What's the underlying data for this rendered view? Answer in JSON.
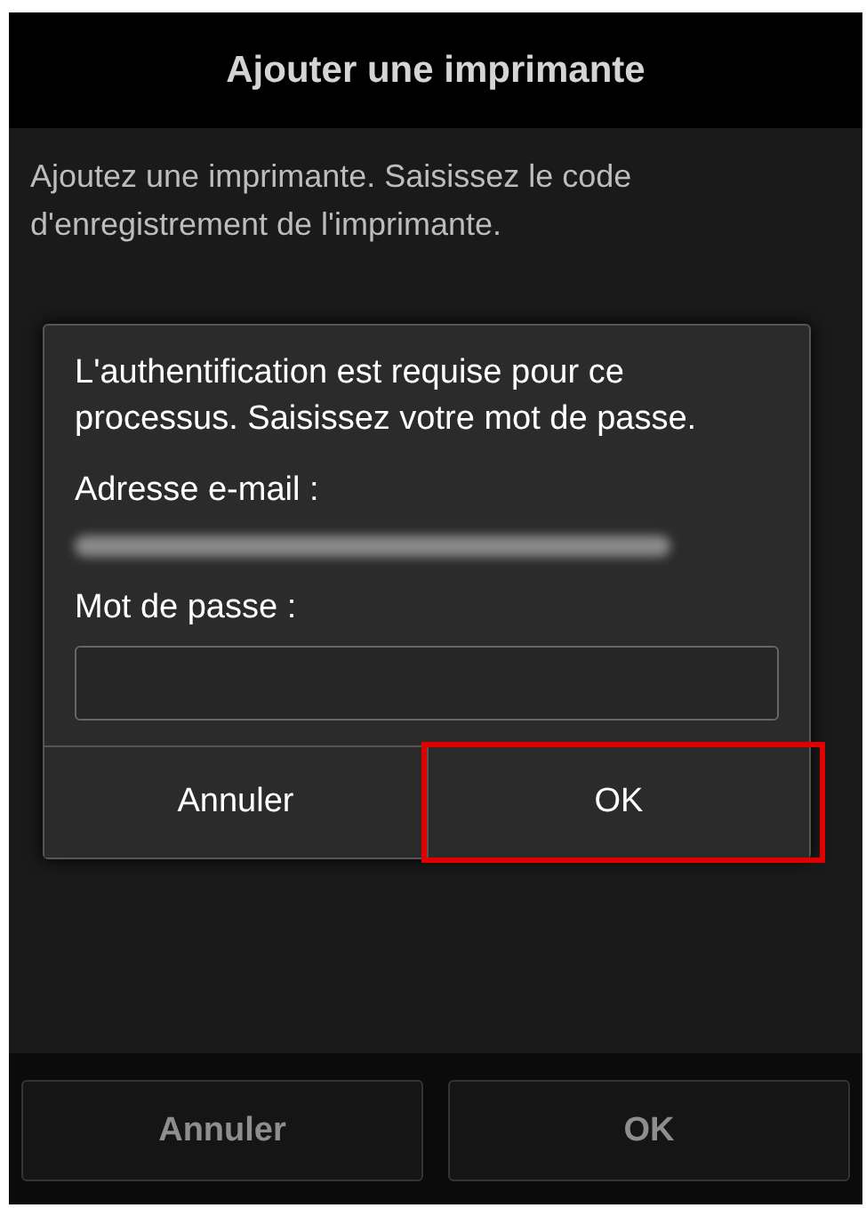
{
  "header": {
    "title": "Ajouter une imprimante"
  },
  "instructions": "Ajoutez une imprimante. Saisissez le code d'enregistrement de l'imprimante.",
  "dialog": {
    "message": "L'authentification est requise pour ce processus. Saisissez votre mot de passe.",
    "email_label": "Adresse e-mail :",
    "email_redacted": true,
    "password_label": "Mot de passe :",
    "buttons": [
      {
        "label": "Annuler",
        "highlighted": false
      },
      {
        "label": "OK",
        "highlighted": true
      }
    ]
  },
  "footer_buttons": [
    {
      "label": "Annuler",
      "dimmed": true
    },
    {
      "label": "OK",
      "dimmed": true
    }
  ]
}
